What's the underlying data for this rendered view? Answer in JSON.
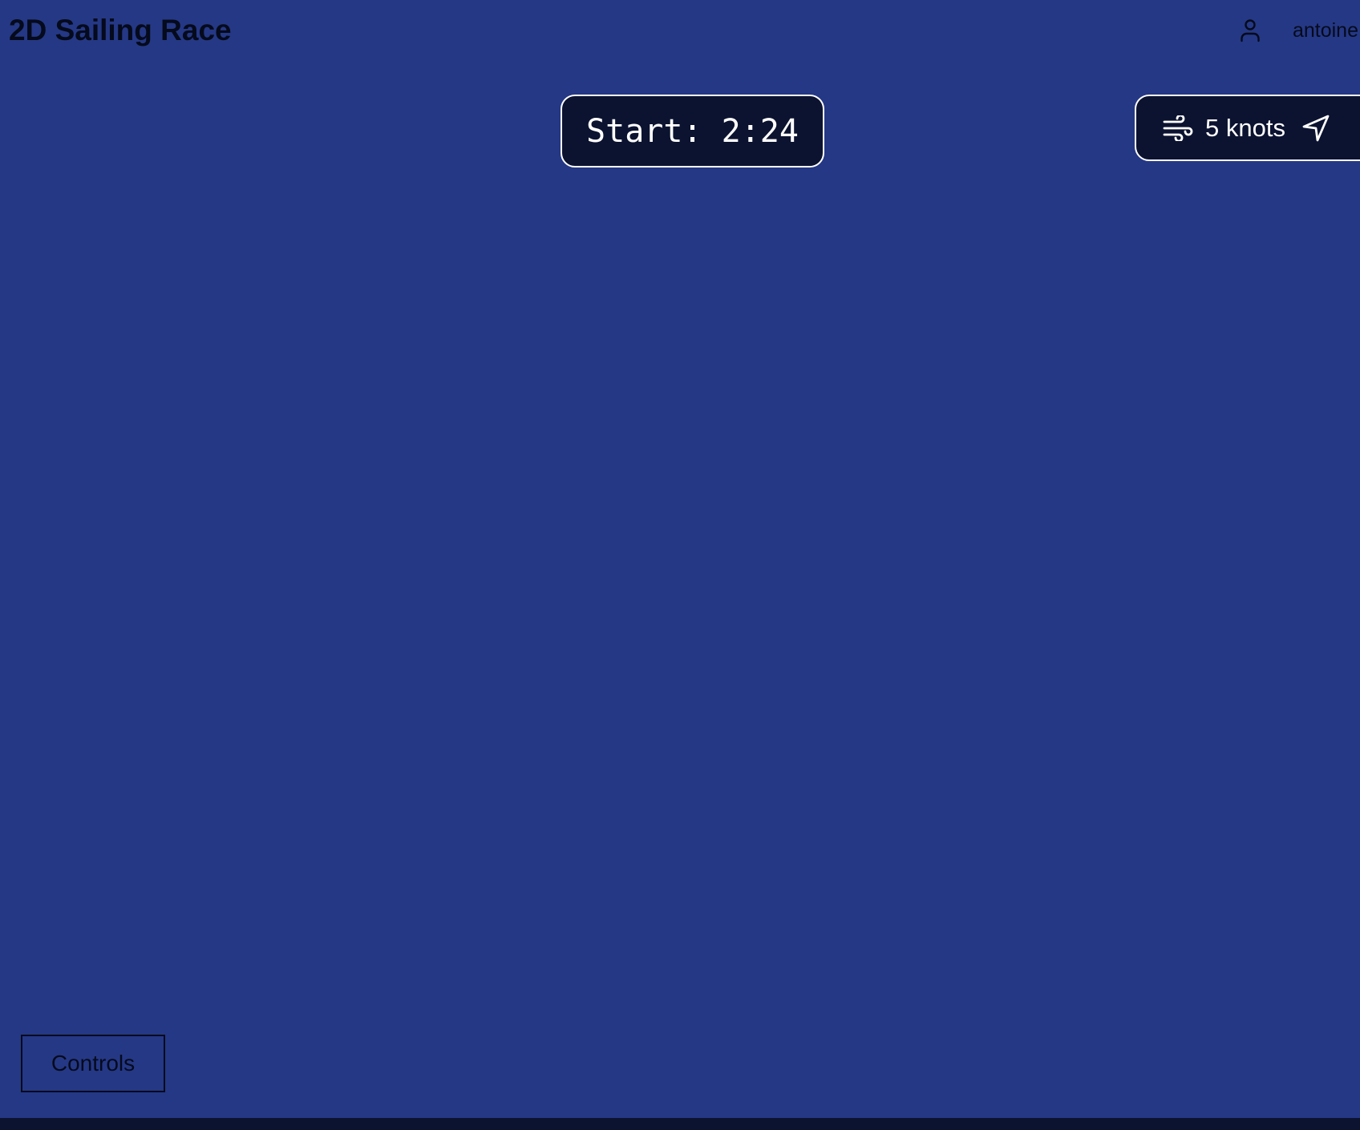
{
  "header": {
    "title": "2D Sailing Race",
    "user_icon": "user-icon",
    "username": "antoine"
  },
  "race": {
    "start_timer": "Start: 2:24"
  },
  "wind": {
    "icon": "wind-icon",
    "speed": "5 knots",
    "direction_icon": "navigation-arrow-icon"
  },
  "controls": {
    "label": "Controls"
  },
  "colors": {
    "sea": "#253885",
    "panel": "#0c1330",
    "panel_border": "#ffffff",
    "text_dark": "#050a1c"
  }
}
